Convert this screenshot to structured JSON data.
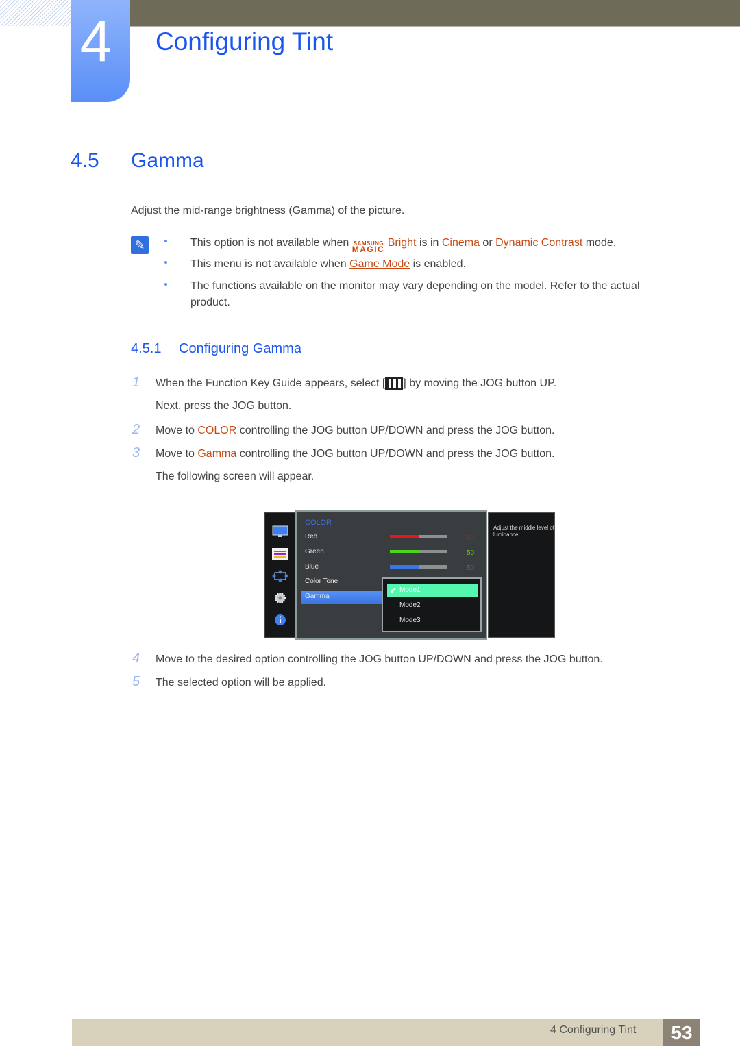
{
  "header": {
    "chapter_number": "4",
    "chapter_title": "Configuring Tint"
  },
  "section": {
    "number": "4.5",
    "title": "Gamma",
    "intro": "Adjust the mid-range brightness (Gamma) of the picture."
  },
  "notes": {
    "icon": "note-pencil-icon",
    "items": [
      {
        "pre": "This option is not available when ",
        "logo_top": "SAMSUNG",
        "logo_bottom": "MAGIC",
        "link": "Bright",
        "mid1": " is in ",
        "hl1": "Cinema",
        "mid2": " or ",
        "hl2": "Dynamic Contrast",
        "post": " mode."
      },
      {
        "pre": "This menu is not available when ",
        "link": "Game Mode",
        "post": " is enabled."
      },
      {
        "line1": "The functions available on the monitor may vary depending on the model. Refer to the actual",
        "line2": "product."
      }
    ]
  },
  "subsection": {
    "number": "4.5.1",
    "title": "Configuring Gamma"
  },
  "steps": [
    {
      "num": "1",
      "pre": "When the Function Key Guide appears, select [",
      "icon": "menu-key-icon",
      "post": "] by moving the JOG button UP.",
      "line2": "Next, press the JOG button."
    },
    {
      "num": "2",
      "pre": "Move to ",
      "hl": "COLOR",
      "post": " controlling the JOG button UP/DOWN and press the JOG button."
    },
    {
      "num": "3",
      "pre": "Move to ",
      "hl": "Gamma",
      "post": " controlling the JOG button UP/DOWN and press the JOG button.",
      "line2": "The following screen will appear."
    },
    {
      "num": "4",
      "text": "Move to the desired option controlling the JOG button UP/DOWN and press the JOG button."
    },
    {
      "num": "5",
      "text": "The selected option will be applied."
    }
  ],
  "osd": {
    "side_icons": [
      "monitor-icon",
      "color-bars-icon",
      "size-position-icon",
      "gear-icon",
      "info-icon"
    ],
    "heading": "COLOR",
    "items": [
      {
        "label": "Red",
        "value": "50",
        "fraction": 0.5,
        "color": "#e8151b"
      },
      {
        "label": "Green",
        "value": "50",
        "fraction": 0.5,
        "color": "#4fd41c"
      },
      {
        "label": "Blue",
        "value": "50",
        "fraction": 0.5,
        "color": "#3b74e4"
      },
      {
        "label": "Color Tone"
      },
      {
        "label": "Gamma",
        "selected": true
      }
    ],
    "dropdown": {
      "options": [
        "Mode1",
        "Mode2",
        "Mode3"
      ],
      "selected": "Mode1"
    },
    "help_text": "Adjust the middle level of luminance."
  },
  "footer": {
    "chapter_label": "4 Configuring Tint",
    "page_number": "53"
  }
}
